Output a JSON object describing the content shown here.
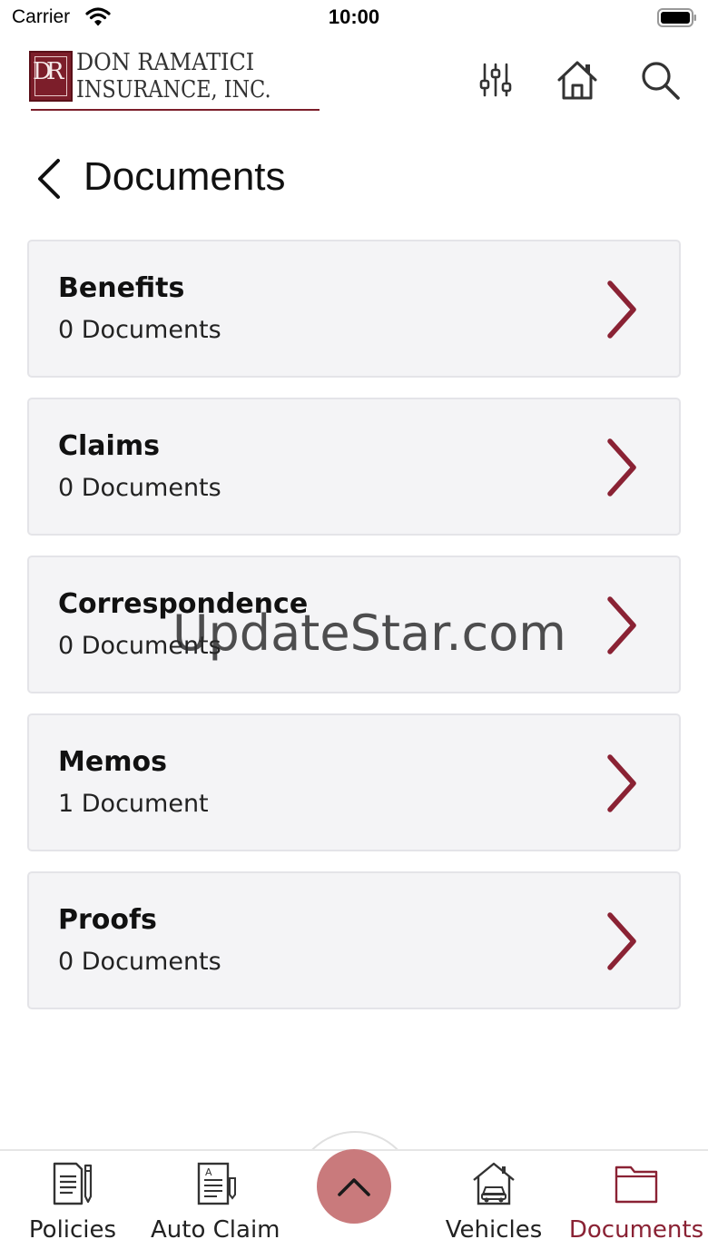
{
  "status_bar": {
    "carrier": "Carrier",
    "time": "10:00"
  },
  "header": {
    "logo_monogram": "DR",
    "logo_line1": "DON RAMATICI",
    "logo_line2": "INSURANCE, INC.",
    "icons": [
      "sliders-icon",
      "home-icon",
      "search-icon"
    ]
  },
  "page": {
    "title": "Documents"
  },
  "documents": [
    {
      "name": "Benefits",
      "count": "0 Documents"
    },
    {
      "name": "Claims",
      "count": "0 Documents"
    },
    {
      "name": "Correspondence",
      "count": "0 Documents"
    },
    {
      "name": "Memos",
      "count": "1 Document"
    },
    {
      "name": "Proofs",
      "count": "0 Documents"
    }
  ],
  "watermark": "UpdateStar.com",
  "tab_bar": {
    "policies": "Policies",
    "auto_claim": "Auto Claim",
    "vehicles": "Vehicles",
    "documents": "Documents",
    "active_tab": "Documents"
  },
  "colors": {
    "accent": "#8a2234",
    "fab": "#c97a7c",
    "card_bg": "#f4f4f6"
  }
}
